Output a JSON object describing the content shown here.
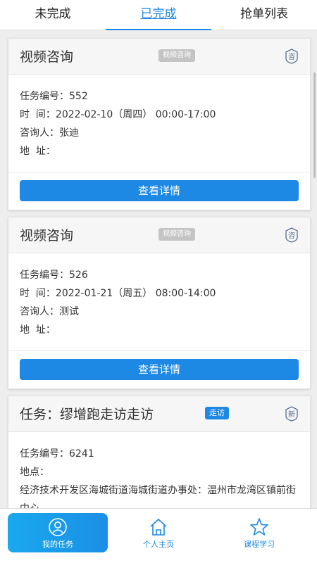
{
  "tabs": [
    {
      "label": "未完成",
      "active": false
    },
    {
      "label": "已完成",
      "active": true
    },
    {
      "label": "抢单列表",
      "active": false
    }
  ],
  "cards": [
    {
      "title": "视频咨询",
      "tag": "视频咨询",
      "seal": "咨",
      "lines": [
        {
          "key": "任务编号：",
          "value": "552"
        },
        {
          "key": "时  间：",
          "value": "2022-02-10（周四） 00:00-17:00"
        },
        {
          "key": "咨询人：",
          "value": "张迪"
        },
        {
          "key": "地  址：",
          "value": ""
        }
      ],
      "button": "查看详情"
    },
    {
      "title": "视频咨询",
      "tag": "视频咨询",
      "seal": "咨",
      "lines": [
        {
          "key": "任务编号：",
          "value": "526"
        },
        {
          "key": "时  间：",
          "value": "2022-01-21（周五） 08:00-14:00"
        },
        {
          "key": "咨询人：",
          "value": "测试"
        },
        {
          "key": "地  址：",
          "value": ""
        }
      ],
      "button": "查看详情"
    },
    {
      "title": "任务：缪增跑走访走访",
      "tag": "走访",
      "seal": "新",
      "lines": [
        {
          "key": "任务编号：",
          "value": "6241"
        },
        {
          "key": "地点：",
          "value": ""
        },
        {
          "key": "",
          "value": "经济技术开发区海城街道海城街道办事处：温州市龙湾区镇前街中心"
        }
      ]
    }
  ],
  "bottom_nav": [
    {
      "label": "我的任务",
      "icon": "user-circle-icon",
      "active": true
    },
    {
      "label": "个人主页",
      "icon": "home-icon",
      "active": false
    },
    {
      "label": "课程学习",
      "icon": "star-icon",
      "active": false
    }
  ],
  "colors": {
    "accent": "#1e88e5",
    "seal": "#5a6e8c",
    "tag_gray": "#c4c4c4"
  }
}
